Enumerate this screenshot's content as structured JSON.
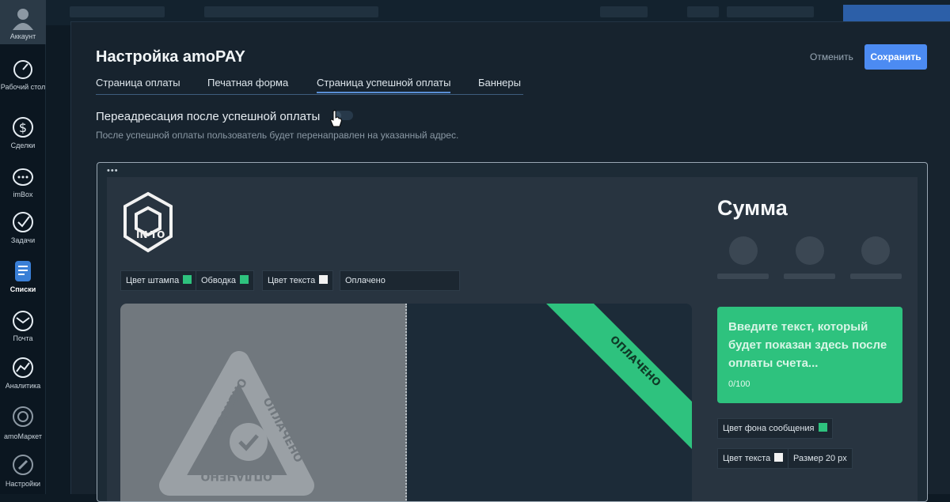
{
  "sidebar": {
    "items": [
      {
        "label": "Аккаунт",
        "icon": "user-avatar-icon"
      },
      {
        "label": "Рабочий стол",
        "icon": "dashboard-icon"
      },
      {
        "label": "Сделки",
        "icon": "dollar-icon"
      },
      {
        "label": "imBox",
        "icon": "chat-icon"
      },
      {
        "label": "Задачи",
        "icon": "checkmark-icon"
      },
      {
        "label": "Списки",
        "icon": "lists-icon"
      },
      {
        "label": "Почта",
        "icon": "mail-icon"
      },
      {
        "label": "Аналитика",
        "icon": "analytics-icon"
      },
      {
        "label": "amoМаркет",
        "icon": "market-icon"
      },
      {
        "label": "Настройки",
        "icon": "settings-icon"
      }
    ]
  },
  "modal": {
    "title": "Настройка amoPAY",
    "cancel_label": "Отменить",
    "save_label": "Сохранить",
    "tabs": [
      {
        "label": "Страница оплаты",
        "active": false
      },
      {
        "label": "Печатная форма",
        "active": false
      },
      {
        "label": "Страница успешной оплаты",
        "active": true
      },
      {
        "label": "Баннеры",
        "active": false
      }
    ],
    "redirect": {
      "label": "Переадресация после успешной оплаты",
      "enabled": false,
      "hint": "После успешной оплаты пользователь будет перенаправлен на указанный адрес."
    }
  },
  "preview": {
    "dots": "•••",
    "stamp_controls": {
      "stamp_color_label": "Цвет штампа",
      "outline_label": "Обводка",
      "text_color_label": "Цвет текста",
      "stamp_text_value": "Оплачено"
    },
    "stamp_text": "ОПЛАЧЕНО",
    "ribbon_text": "ОПЛАЧЕНО",
    "sum_title": "Сумма",
    "message": {
      "placeholder": "Введите текст, который будет показан здесь после оплаты счета...",
      "counter": "0/100"
    },
    "message_controls": {
      "bg_color_label": "Цвет фона сообщения",
      "text_color_label": "Цвет текста",
      "size_label": "Размер 20 px"
    }
  },
  "colors": {
    "accent_green": "#2ec27e",
    "accent_blue": "#4c8bf2",
    "background": "#17232e",
    "swatch_white": "#f2f2f2"
  }
}
